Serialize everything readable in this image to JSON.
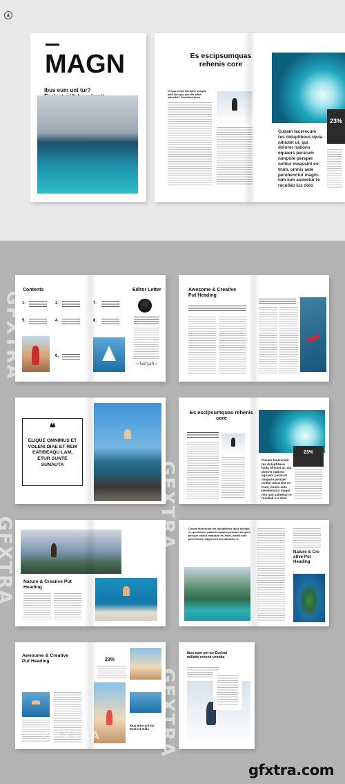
{
  "hero": {
    "cover_title": "MAGN",
    "cover_subtitle": "Ibus eum unt tur? Evelest millabo rehenit vendita",
    "spread_heading": "Es escipsumquas rehenis core",
    "spread_lead": "Ut quo conse bla dolor volupta aditi ium quo que dio officii adiscitet? Omnidunt arum",
    "pull_quote": "Cusam facerecum res doluptibeus iquia nihictet ur, qui dolorer nations equaers perarum nimpore persper ovitiur moassint es- trum, omnis aute perehenctur magni- nim ium asimetur re recullab ius dolo",
    "stat": "23%"
  },
  "contents": {
    "title": "Contents",
    "editor_title": "Editor Letter",
    "items": [
      "1.",
      "2.",
      "5.",
      "4.",
      "6.",
      "7.",
      "8."
    ]
  },
  "feature": {
    "heading": "Awesome & Creative Put Heading"
  },
  "quote_page": {
    "quote": "ELIQUE OMNIMUS ET VOLENI DIAE ET REM EATIBEAQU LAM, ETUR SUNTE SUNAUTA"
  },
  "spread_mid": {
    "heading": "Es escipsumquas rehenis core",
    "pull_quote": "Cusam facerecum res doluptibeus iquia nihictet ur, qui dolorer nations equaers perarum nimpore persper ovitiur moassint es- trum, omnis aute perehenctur magni nim ium asimetur re recullab ius dolo",
    "stat": "23%"
  },
  "nature": {
    "heading": "Nature & Creative Put Heading"
  },
  "lagoon_page": {
    "lead": "Cusam facerecum res doluptibeus iquia nihictet ur, qui dolorer nations equaers perarum nimpore persper ovitiur moassint es- trum, omnis aute perehenctur magni nim ium asimetur re",
    "side_heading": "Nature & Cre ative Put Heading"
  },
  "last_left": {
    "heading": "Awesome & Creative Put Heading",
    "stat": "23%",
    "caption": "Ibus eum unt tur Evelest milla"
  },
  "last_right": {
    "heading": "Ibus eum unt tur Evelest millabo rehenit vendita"
  },
  "watermark": {
    "text": "GFXTRA"
  },
  "footer": {
    "site": "gfxtra.com"
  }
}
